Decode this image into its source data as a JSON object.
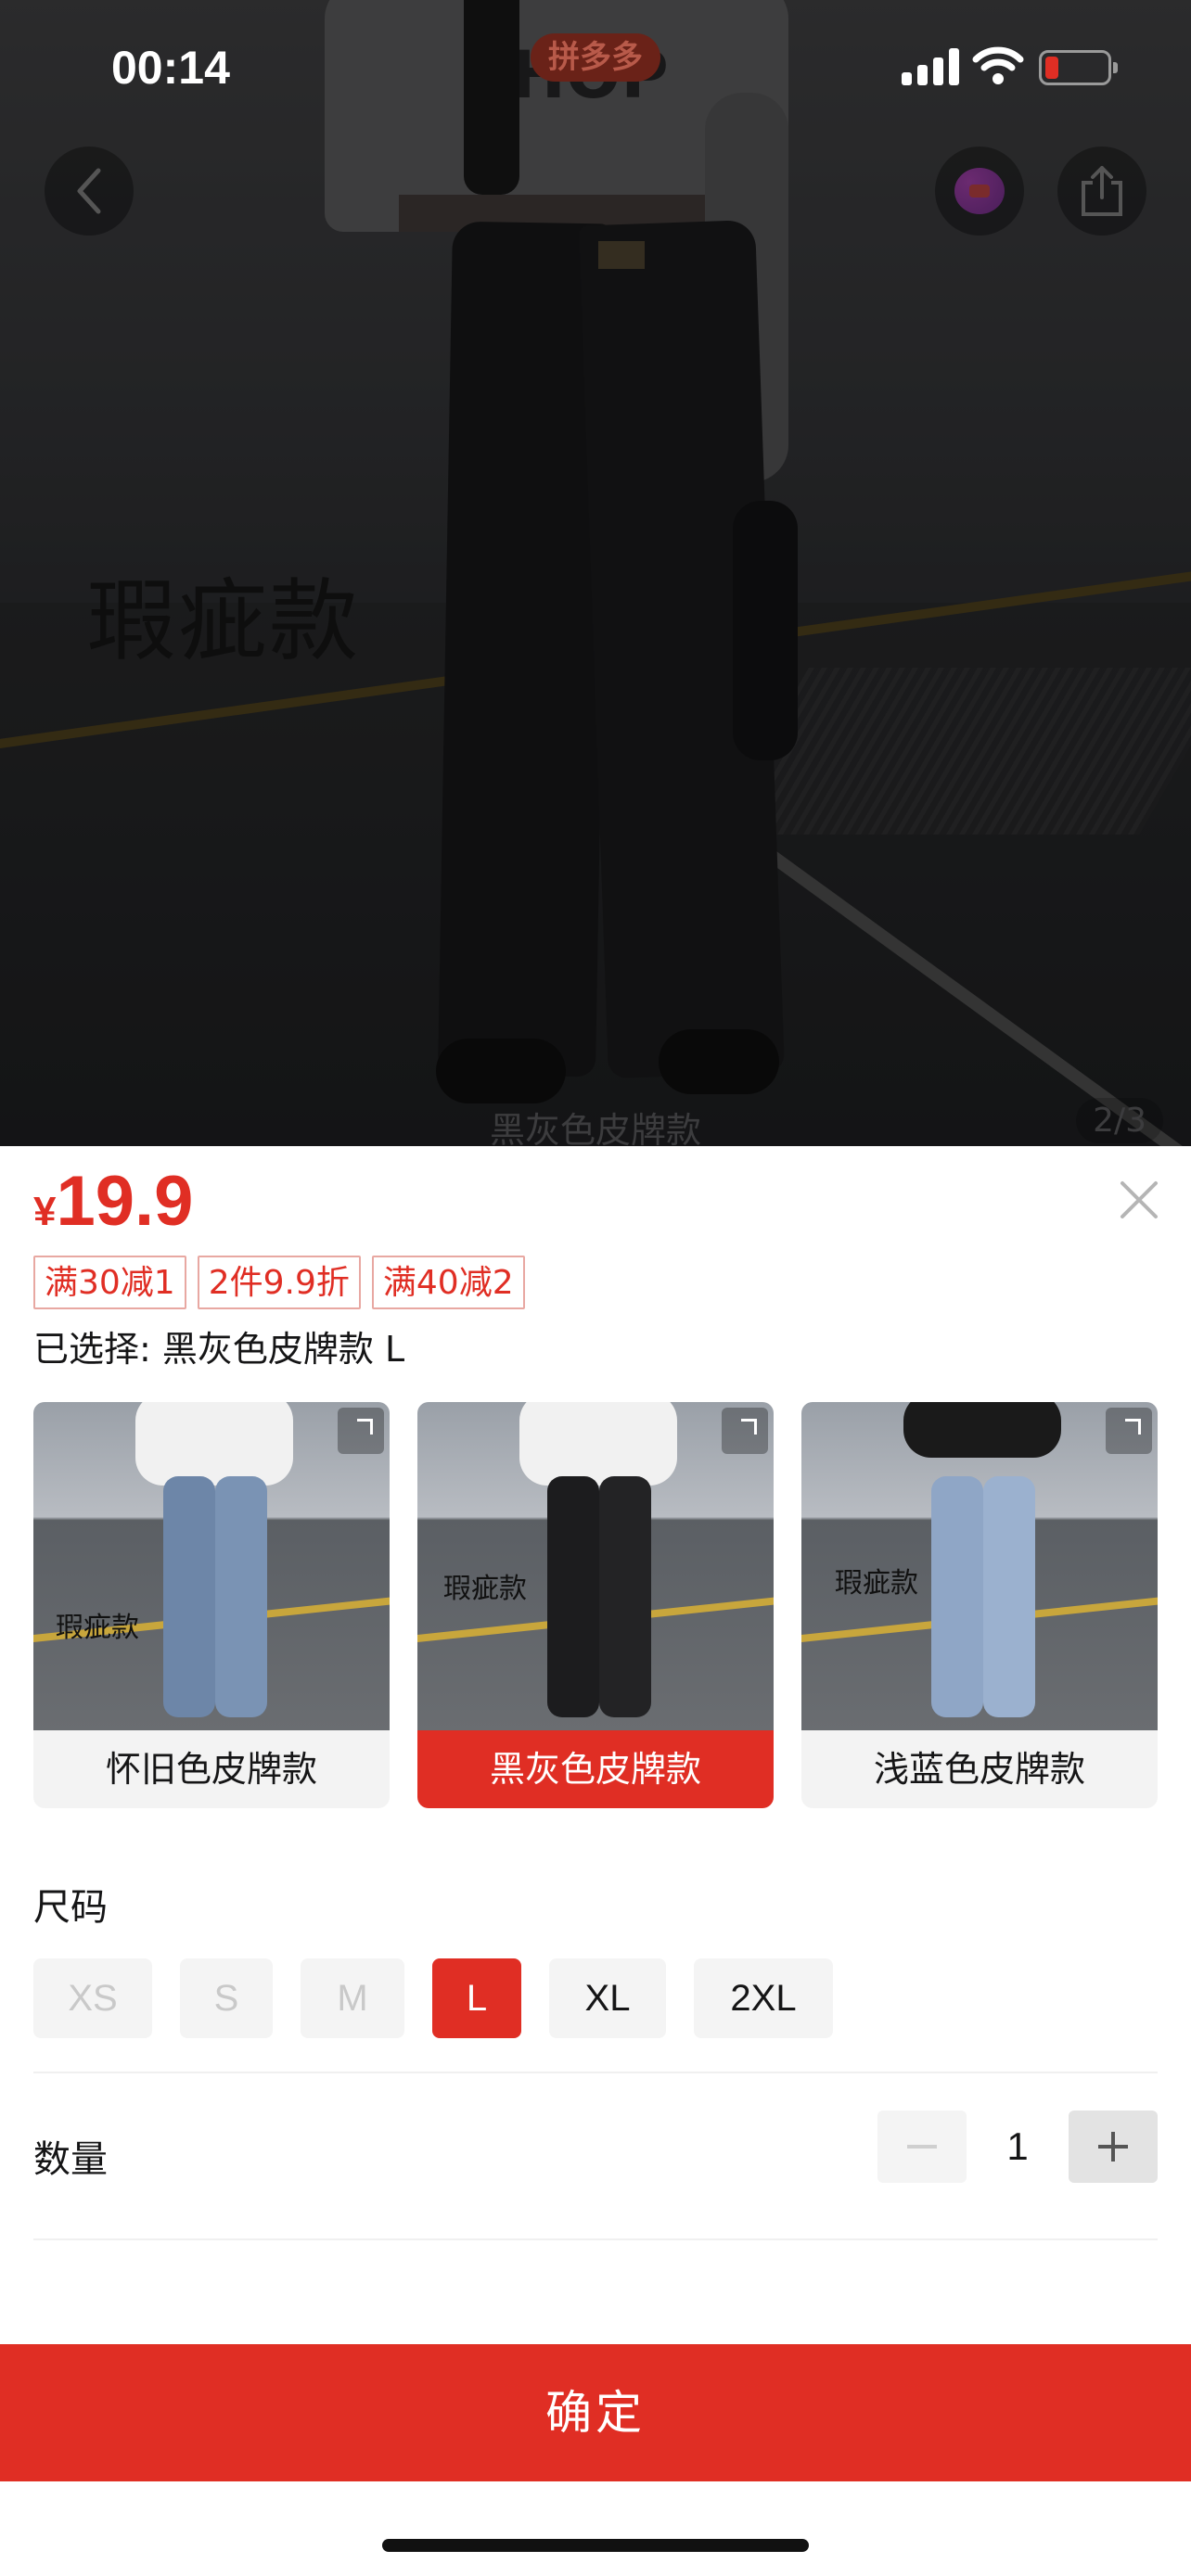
{
  "status_bar": {
    "time": "00:14",
    "brand": "拼多多"
  },
  "hero": {
    "overlay_label": "瑕疵款",
    "caption": "黑灰色皮牌款",
    "counter": "2/3"
  },
  "icons": {
    "back": "chevron-left-icon",
    "favorite": "heart-icon",
    "share": "share-icon",
    "close": "close-icon"
  },
  "sheet": {
    "price_currency": "¥",
    "price_value": "19.9",
    "promotions": [
      "满30减1",
      "2件9.9折",
      "满40减2"
    ],
    "selected_text": "已选择: 黑灰色皮牌款 L",
    "variants": [
      {
        "label": "怀旧色皮牌款",
        "tag": "瑕疵款",
        "selected": false
      },
      {
        "label": "黑灰色皮牌款",
        "tag": "瑕疵款",
        "selected": true
      },
      {
        "label": "浅蓝色皮牌款",
        "tag": "瑕疵款",
        "selected": false
      }
    ],
    "size_title": "尺码",
    "sizes": [
      {
        "label": "XS",
        "state": "disabled"
      },
      {
        "label": "S",
        "state": "disabled"
      },
      {
        "label": "M",
        "state": "disabled"
      },
      {
        "label": "L",
        "state": "selected"
      },
      {
        "label": "XL",
        "state": "available"
      },
      {
        "label": "2XL",
        "state": "available"
      }
    ],
    "quantity_title": "数量",
    "quantity": "1",
    "confirm_label": "确定"
  },
  "colors": {
    "accent": "#e02e24",
    "promo_border": "#e8a8a2"
  }
}
